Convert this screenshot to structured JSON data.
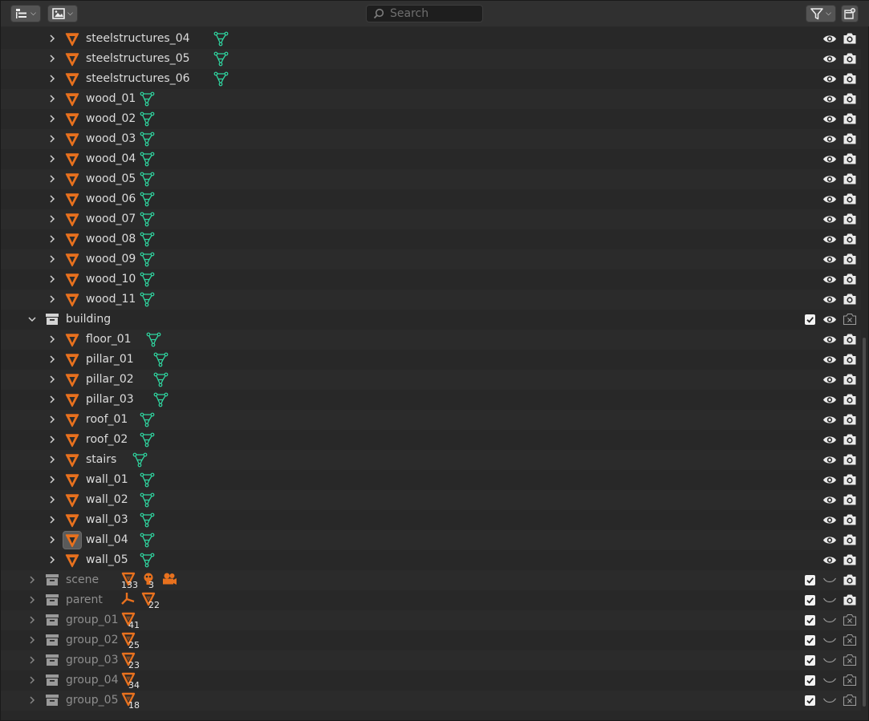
{
  "header": {
    "search_placeholder": "Search",
    "display_mode_icon": "outliner-icon",
    "view_layer_icon": "image-filter-icon",
    "filter_icon": "funnel-icon",
    "new_collection_icon": "new-collection-icon"
  },
  "colors": {
    "object_orange": "#e8711e",
    "mesh_green": "#2fd6a0",
    "text": "#dcdcdc",
    "text_dim": "#8e8e8e"
  },
  "rows": [
    {
      "name": "steelstructures_04",
      "kind": "object",
      "eye": "on",
      "camera": "on"
    },
    {
      "name": "steelstructures_05",
      "kind": "object",
      "eye": "on",
      "camera": "on"
    },
    {
      "name": "steelstructures_06",
      "kind": "object",
      "eye": "on",
      "camera": "on"
    },
    {
      "name": "wood_01",
      "kind": "object",
      "eye": "on",
      "camera": "on"
    },
    {
      "name": "wood_02",
      "kind": "object",
      "eye": "on",
      "camera": "on"
    },
    {
      "name": "wood_03",
      "kind": "object",
      "eye": "on",
      "camera": "on"
    },
    {
      "name": "wood_04",
      "kind": "object",
      "eye": "on",
      "camera": "on"
    },
    {
      "name": "wood_05",
      "kind": "object",
      "eye": "on",
      "camera": "on"
    },
    {
      "name": "wood_06",
      "kind": "object",
      "eye": "on",
      "camera": "on"
    },
    {
      "name": "wood_07",
      "kind": "object",
      "eye": "on",
      "camera": "on"
    },
    {
      "name": "wood_08",
      "kind": "object",
      "eye": "on",
      "camera": "on"
    },
    {
      "name": "wood_09",
      "kind": "object",
      "eye": "on",
      "camera": "on"
    },
    {
      "name": "wood_10",
      "kind": "object",
      "eye": "on",
      "camera": "on"
    },
    {
      "name": "wood_11",
      "kind": "object",
      "eye": "on",
      "camera": "on"
    },
    {
      "name": "building",
      "kind": "collection",
      "expanded": true,
      "checkbox": true,
      "eye": "on",
      "camera": "off"
    },
    {
      "name": "floor_01",
      "kind": "object",
      "eye": "on",
      "camera": "on"
    },
    {
      "name": "pillar_01",
      "kind": "object",
      "eye": "on",
      "camera": "on"
    },
    {
      "name": "pillar_02",
      "kind": "object",
      "eye": "on",
      "camera": "on"
    },
    {
      "name": "pillar_03",
      "kind": "object",
      "eye": "on",
      "camera": "on"
    },
    {
      "name": "roof_01",
      "kind": "object",
      "eye": "on",
      "camera": "on"
    },
    {
      "name": "roof_02",
      "kind": "object",
      "eye": "on",
      "camera": "on"
    },
    {
      "name": "stairs",
      "kind": "object",
      "eye": "on",
      "camera": "on"
    },
    {
      "name": "wall_01",
      "kind": "object",
      "eye": "on",
      "camera": "on"
    },
    {
      "name": "wall_02",
      "kind": "object",
      "eye": "on",
      "camera": "on"
    },
    {
      "name": "wall_03",
      "kind": "object",
      "eye": "on",
      "camera": "on"
    },
    {
      "name": "wall_04",
      "kind": "object",
      "active": true,
      "eye": "on",
      "camera": "on"
    },
    {
      "name": "wall_05",
      "kind": "object",
      "eye": "on",
      "camera": "on"
    },
    {
      "name": "scene",
      "kind": "collection",
      "expanded": false,
      "checkbox": true,
      "eye": "hidden",
      "camera": "on",
      "badges": [
        {
          "icon": "mesh-object-icon",
          "count": "133"
        },
        {
          "icon": "light-icon",
          "count": "3"
        },
        {
          "icon": "camera-object-icon",
          "count": ""
        }
      ]
    },
    {
      "name": "parent",
      "kind": "collection",
      "expanded": false,
      "checkbox": true,
      "eye": "hidden",
      "camera": "on",
      "badges": [
        {
          "icon": "empty-object-icon",
          "count": ""
        },
        {
          "icon": "mesh-object-icon",
          "count": "22"
        }
      ]
    },
    {
      "name": "group_01",
      "kind": "collection",
      "expanded": false,
      "checkbox": true,
      "eye": "hidden",
      "camera": "off",
      "badges": [
        {
          "icon": "mesh-object-icon",
          "count": "41"
        }
      ]
    },
    {
      "name": "group_02",
      "kind": "collection",
      "expanded": false,
      "checkbox": true,
      "eye": "hidden",
      "camera": "off",
      "badges": [
        {
          "icon": "mesh-object-icon",
          "count": "25"
        }
      ]
    },
    {
      "name": "group_03",
      "kind": "collection",
      "expanded": false,
      "checkbox": true,
      "eye": "hidden",
      "camera": "off",
      "badges": [
        {
          "icon": "mesh-object-icon",
          "count": "23"
        }
      ]
    },
    {
      "name": "group_04",
      "kind": "collection",
      "expanded": false,
      "checkbox": true,
      "eye": "hidden",
      "camera": "off",
      "badges": [
        {
          "icon": "mesh-object-icon",
          "count": "34"
        }
      ]
    },
    {
      "name": "group_05",
      "kind": "collection",
      "expanded": false,
      "checkbox": true,
      "eye": "hidden",
      "camera": "off",
      "badges": [
        {
          "icon": "mesh-object-icon",
          "count": "18"
        }
      ]
    }
  ]
}
